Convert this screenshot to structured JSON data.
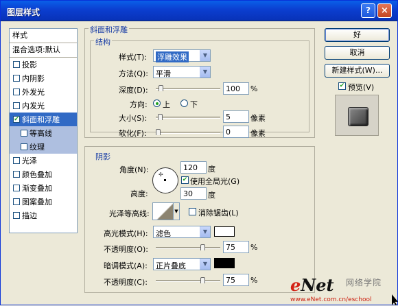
{
  "window": {
    "title": "图层样式",
    "help_glyph": "?",
    "close_glyph": "×"
  },
  "sidebar": {
    "header": "样式",
    "blend": "混合选项:默认",
    "items": [
      {
        "label": "投影",
        "checked": false
      },
      {
        "label": "内阴影",
        "checked": false
      },
      {
        "label": "外发光",
        "checked": false
      },
      {
        "label": "内发光",
        "checked": false
      },
      {
        "label": "斜面和浮雕",
        "checked": true,
        "selected": true
      },
      {
        "label": "等高线",
        "checked": false,
        "sub": true
      },
      {
        "label": "纹理",
        "checked": false,
        "sub": true
      },
      {
        "label": "光泽",
        "checked": false
      },
      {
        "label": "颜色叠加",
        "checked": false
      },
      {
        "label": "渐变叠加",
        "checked": false
      },
      {
        "label": "图案叠加",
        "checked": false
      },
      {
        "label": "描边",
        "checked": false
      }
    ]
  },
  "bevel": {
    "group_title": "斜面和浮雕",
    "structure_title": "结构",
    "style_label": "样式(T):",
    "style_value": "浮雕效果",
    "technique_label": "方法(Q):",
    "technique_value": "平滑",
    "depth_label": "深度(D):",
    "depth_value": "100",
    "depth_unit": "%",
    "depth_fraction": 0.05,
    "direction_label": "方向:",
    "dir_up": "上",
    "dir_down": "下",
    "direction_selected": "上",
    "size_label": "大小(S):",
    "size_value": "5",
    "size_unit": "像素",
    "size_fraction": 0.03,
    "soften_label": "软化(F):",
    "soften_value": "0",
    "soften_unit": "像素",
    "soften_fraction": 0.0
  },
  "shading": {
    "title": "阴影",
    "angle_label": "角度(N):",
    "angle_value": "120",
    "angle_unit": "度",
    "global_light_label": "使用全局光(G)",
    "global_light": true,
    "altitude_label": "高度:",
    "altitude_value": "30",
    "altitude_unit": "度",
    "gloss_label": "光泽等高线:",
    "antialias_label": "消除锯齿(L)",
    "antialias": false,
    "highlight_label": "高光模式(H):",
    "highlight_mode": "滤色",
    "highlight_color": "#ffffff",
    "opacity_label": "不透明度(O):",
    "highlight_opacity": "75",
    "opacity_unit": "%",
    "highlight_fraction": 0.75,
    "shadow_label": "暗调模式(A):",
    "shadow_mode": "正片叠底",
    "shadow_color": "#000000",
    "shadow_opacity_label": "不透明度(C):",
    "shadow_opacity": "75",
    "shadow_fraction": 0.75
  },
  "buttons": {
    "ok": "好",
    "cancel": "取消",
    "new_style": "新建样式(W)...",
    "preview_label": "预览(V)",
    "preview": true
  },
  "watermark": {
    "e": "e",
    "net": "Net",
    "cn": "网络学院",
    "url": "www.eNet.com.cn/eschool"
  }
}
